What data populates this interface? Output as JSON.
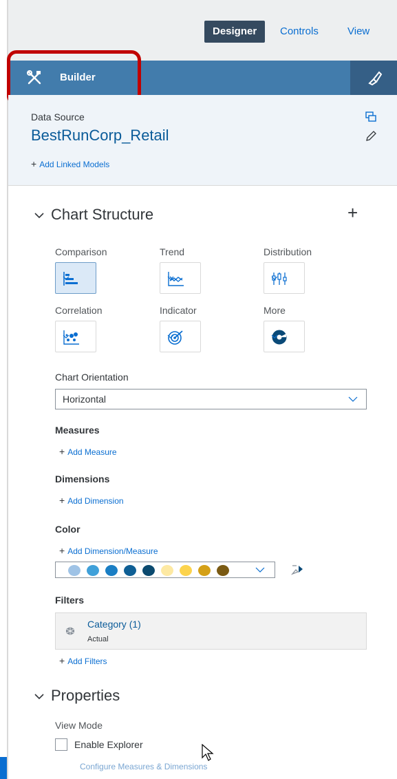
{
  "tabs": {
    "designer": "Designer",
    "controls": "Controls",
    "view": "View"
  },
  "builder": {
    "label": "Builder",
    "icon": "tools-icon",
    "styling_icon": "paintbrush-icon"
  },
  "data_source": {
    "label": "Data Source",
    "name": "BestRunCorp_Retail",
    "add_linked": "Add Linked Models"
  },
  "chart_structure": {
    "title": "Chart Structure",
    "types": {
      "comparison": "Comparison",
      "trend": "Trend",
      "distribution": "Distribution",
      "correlation": "Correlation",
      "indicator": "Indicator",
      "more": "More"
    },
    "selected_type": "comparison",
    "orientation_label": "Chart Orientation",
    "orientation_value": "Horizontal",
    "measures_label": "Measures",
    "add_measure": "Add Measure",
    "dimensions_label": "Dimensions",
    "add_dimension": "Add Dimension",
    "color_label": "Color",
    "add_color": "Add Dimension/Measure",
    "palette": [
      "#9fc3e6",
      "#3fa0d9",
      "#1a7ec4",
      "#0f5f95",
      "#0b4a6f",
      "#fde9a3",
      "#fcd34d",
      "#d4a017",
      "#7a5a13"
    ],
    "filters_label": "Filters",
    "filter": {
      "name": "Category (1)",
      "sub": "Actual"
    },
    "add_filters": "Add Filters"
  },
  "properties": {
    "title": "Properties",
    "view_mode": "View Mode",
    "enable_explorer": "Enable Explorer",
    "configure": "Configure Measures & Dimensions"
  },
  "colors": {
    "accent": "#0a6ed1",
    "builder_bar": "#427cac",
    "highlight": "#c00000"
  }
}
